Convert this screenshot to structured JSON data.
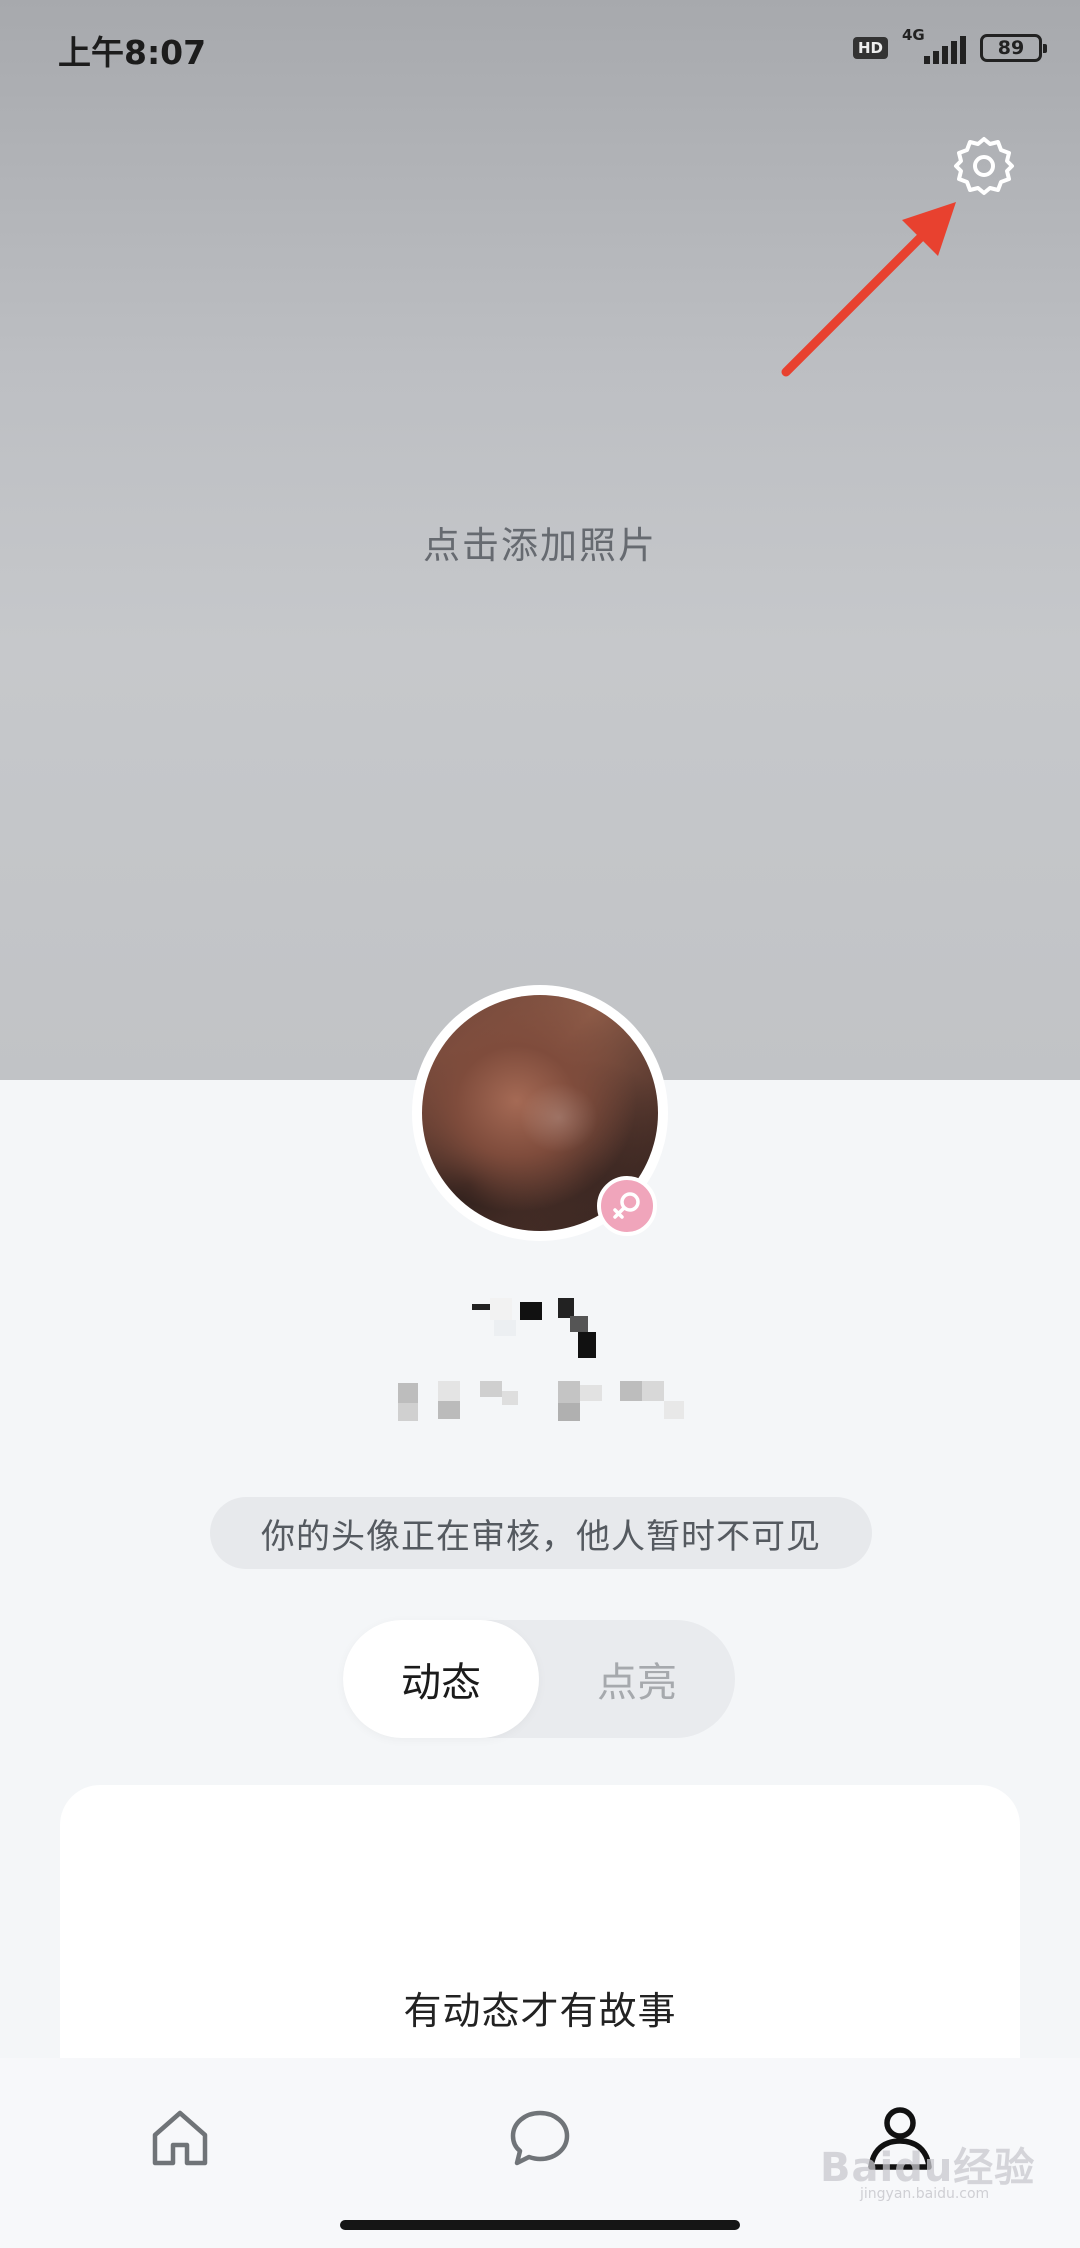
{
  "status_bar": {
    "time": "上午8:07",
    "hd": "HD",
    "network": "4G",
    "battery": "89"
  },
  "cover": {
    "hint": "点击添加照片"
  },
  "profile": {
    "notice": "你的头像正在审核，他人暂时不可见"
  },
  "tabs": {
    "active": "动态",
    "inactive": "点亮"
  },
  "feed": {
    "empty_text": "有动态才有故事"
  },
  "watermark": {
    "text": "Baidu经验",
    "sub": "jingyan.baidu.com"
  },
  "colors": {
    "accent_arrow": "#e8412f",
    "gender_badge": "#f0a5bb"
  },
  "icons": {
    "settings": "gear-icon",
    "gender": "female-icon",
    "home": "home-icon",
    "messages": "chat-bubble-icon",
    "me": "person-icon"
  }
}
